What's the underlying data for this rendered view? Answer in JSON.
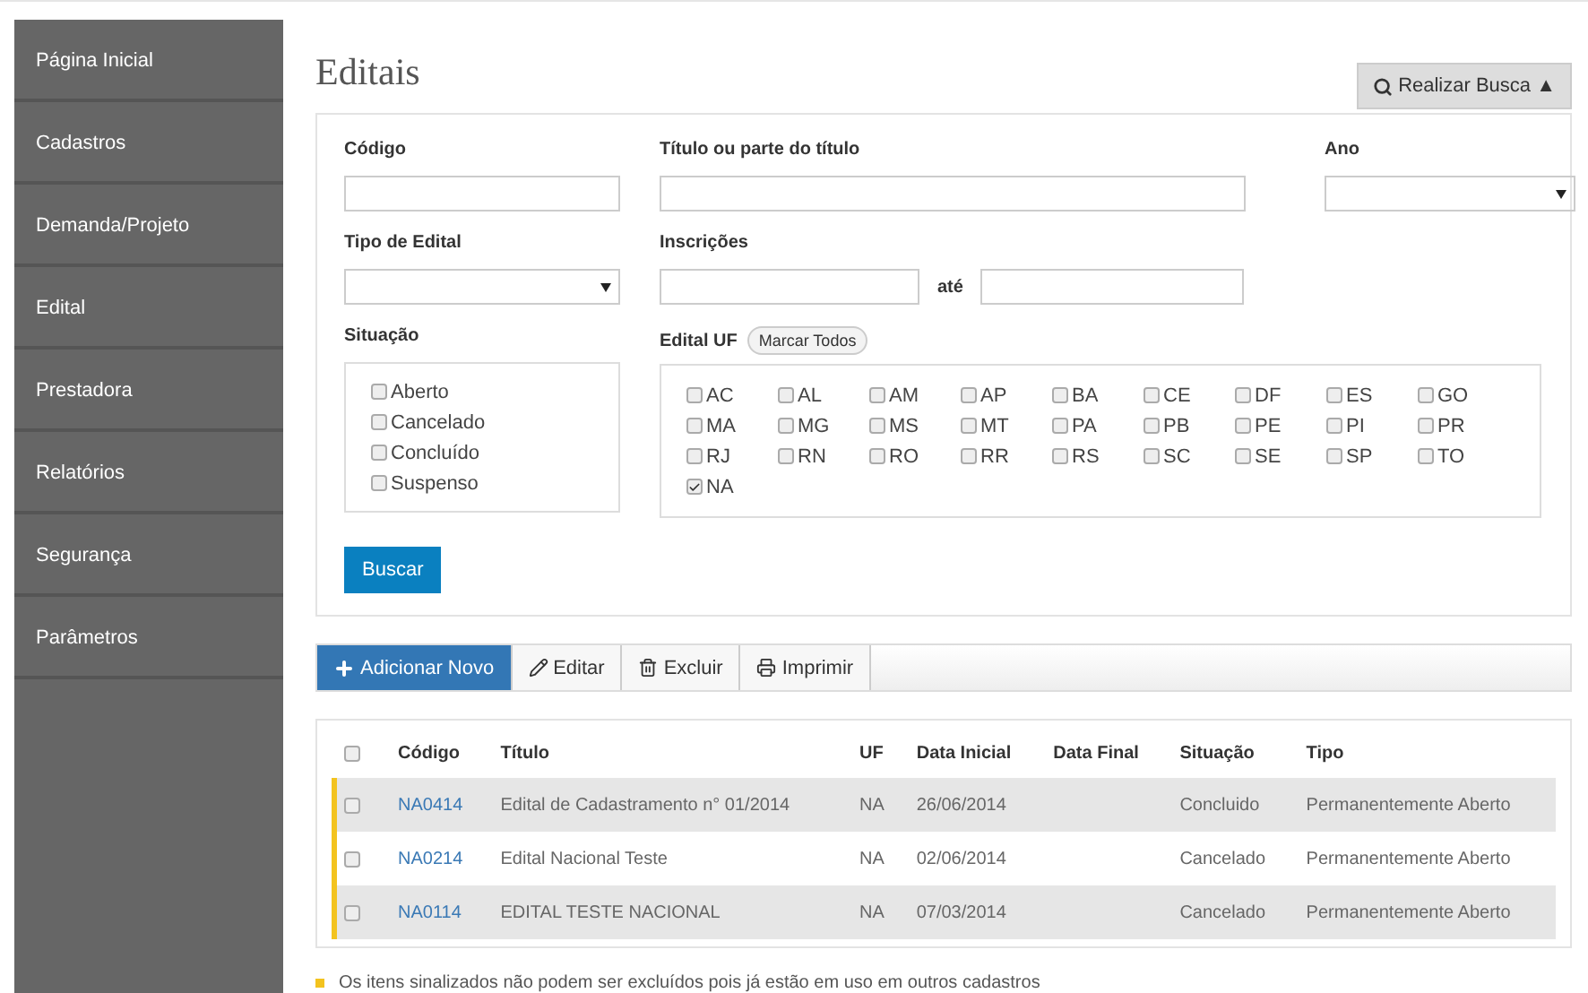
{
  "sidebar": {
    "items": [
      {
        "label": "Página Inicial"
      },
      {
        "label": "Cadastros"
      },
      {
        "label": "Demanda/Projeto"
      },
      {
        "label": "Edital"
      },
      {
        "label": "Prestadora"
      },
      {
        "label": "Relatórios"
      },
      {
        "label": "Segurança"
      },
      {
        "label": "Parâmetros"
      }
    ]
  },
  "page_title": "Editais",
  "search_toggle": {
    "label": "Realizar Busca",
    "arrow": "▲"
  },
  "filters": {
    "codigo": {
      "label": "Código"
    },
    "titulo": {
      "label": "Título ou parte do título"
    },
    "ano": {
      "label": "Ano"
    },
    "tipo": {
      "label": "Tipo de Edital"
    },
    "inscricoes": {
      "label": "Inscrições",
      "between": "até"
    },
    "situacao": {
      "label": "Situação",
      "options": [
        {
          "label": "Aberto",
          "checked": false
        },
        {
          "label": "Cancelado",
          "checked": false
        },
        {
          "label": "Concluído",
          "checked": false
        },
        {
          "label": "Suspenso",
          "checked": false
        }
      ]
    },
    "uf": {
      "label": "Edital UF",
      "mark_all": "Marcar Todos",
      "options": [
        {
          "label": "AC",
          "checked": false
        },
        {
          "label": "AL",
          "checked": false
        },
        {
          "label": "AM",
          "checked": false
        },
        {
          "label": "AP",
          "checked": false
        },
        {
          "label": "BA",
          "checked": false
        },
        {
          "label": "CE",
          "checked": false
        },
        {
          "label": "DF",
          "checked": false
        },
        {
          "label": "ES",
          "checked": false
        },
        {
          "label": "GO",
          "checked": false
        },
        {
          "label": "MA",
          "checked": false
        },
        {
          "label": "MG",
          "checked": false
        },
        {
          "label": "MS",
          "checked": false
        },
        {
          "label": "MT",
          "checked": false
        },
        {
          "label": "PA",
          "checked": false
        },
        {
          "label": "PB",
          "checked": false
        },
        {
          "label": "PE",
          "checked": false
        },
        {
          "label": "PI",
          "checked": false
        },
        {
          "label": "PR",
          "checked": false
        },
        {
          "label": "RJ",
          "checked": false
        },
        {
          "label": "RN",
          "checked": false
        },
        {
          "label": "RO",
          "checked": false
        },
        {
          "label": "RR",
          "checked": false
        },
        {
          "label": "RS",
          "checked": false
        },
        {
          "label": "SC",
          "checked": false
        },
        {
          "label": "SE",
          "checked": false
        },
        {
          "label": "SP",
          "checked": false
        },
        {
          "label": "TO",
          "checked": false
        },
        {
          "label": "NA",
          "checked": true
        }
      ]
    },
    "submit": "Buscar"
  },
  "toolbar": [
    {
      "kind": "add",
      "label": "Adicionar Novo"
    },
    {
      "kind": "edit",
      "label": "Editar"
    },
    {
      "kind": "delete",
      "label": "Excluir"
    },
    {
      "kind": "print",
      "label": "Imprimir"
    }
  ],
  "table": {
    "all_selected": false,
    "columns": [
      "Código",
      "Título",
      "UF",
      "Data Inicial",
      "Data Final",
      "Situação",
      "Tipo"
    ],
    "rows": [
      {
        "selected": false,
        "flagged": true,
        "cells": [
          "NA0414",
          "Edital de Cadastramento n° 01/2014",
          "NA",
          "26/06/2014",
          "",
          "Concluido",
          "Permanentemente Aberto"
        ]
      },
      {
        "selected": false,
        "flagged": true,
        "cells": [
          "NA0214",
          "Edital Nacional Teste",
          "NA",
          "02/06/2014",
          "",
          "Cancelado",
          "Permanentemente Aberto"
        ]
      },
      {
        "selected": false,
        "flagged": true,
        "cells": [
          "NA0114",
          "EDITAL TESTE NACIONAL",
          "NA",
          "07/03/2014",
          "",
          "Cancelado",
          "Permanentemente Aberto"
        ]
      }
    ]
  },
  "note": "Os itens sinalizados não podem ser excluídos pois já estão em uso em outros cadastros"
}
